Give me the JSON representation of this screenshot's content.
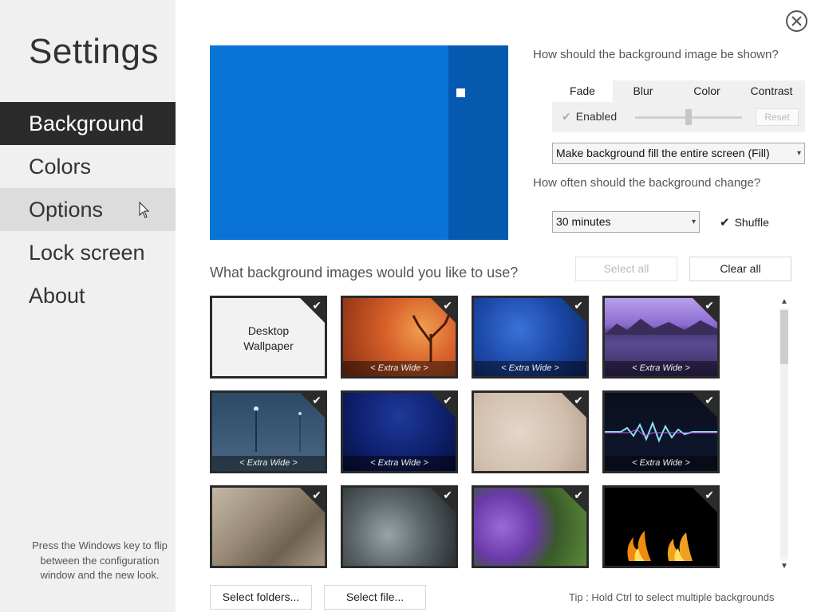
{
  "app": {
    "title": "Settings",
    "close_icon": "close-circle-icon"
  },
  "sidebar": {
    "items": [
      {
        "label": "Background",
        "state": "active"
      },
      {
        "label": "Colors",
        "state": "normal"
      },
      {
        "label": "Options",
        "state": "hover"
      },
      {
        "label": "Lock screen",
        "state": "normal"
      },
      {
        "label": "About",
        "state": "normal"
      }
    ],
    "tip": "Press the Windows key to flip between the configuration window and the new look."
  },
  "preview": {
    "main_color": "#0a74d6",
    "panel_color": "#055ab0"
  },
  "display": {
    "question": "How should the background image be shown?",
    "tabs": [
      "Fade",
      "Blur",
      "Color",
      "Contrast"
    ],
    "selected_tab": "Fade",
    "enabled_label": "Enabled",
    "slider_value": 0.5,
    "reset_label": "Reset",
    "fill_mode": "Make background fill the entire screen (Fill)"
  },
  "change": {
    "question": "How often should the background change?",
    "interval": "30 minutes",
    "shuffle_label": "Shuffle",
    "shuffle_checked": true
  },
  "images": {
    "question": "What background images would you like to use?",
    "select_all": "Select all",
    "clear_all": "Clear all",
    "desktop_line1": "Desktop",
    "desktop_line2": "Wallpaper",
    "extra_wide_label": "< Extra Wide >",
    "items": [
      {
        "type": "desktop",
        "checked": true
      },
      {
        "type": "autumn-tree",
        "extra_wide": true,
        "checked": true
      },
      {
        "type": "blue-bokeh",
        "extra_wide": true,
        "checked": true
      },
      {
        "type": "purple-mountain-lake",
        "extra_wide": true,
        "checked": true
      },
      {
        "type": "foggy-street-lamps",
        "extra_wide": false,
        "checked": true
      },
      {
        "type": "dark-blue-stars",
        "extra_wide": true,
        "checked": true
      },
      {
        "type": "beige-paper",
        "extra_wide": false,
        "checked": true
      },
      {
        "type": "sound-wave",
        "extra_wide": true,
        "checked": true
      },
      {
        "type": "stone-pavement",
        "extra_wide": false,
        "checked": true
      },
      {
        "type": "clay-pot",
        "extra_wide": false,
        "checked": true
      },
      {
        "type": "purple-vase",
        "extra_wide": false,
        "checked": true
      },
      {
        "type": "fire",
        "extra_wide": false,
        "checked": true
      }
    ]
  },
  "footer": {
    "select_folders": "Select folders...",
    "select_file": "Select file...",
    "tip": "Tip : Hold Ctrl to select multiple backgrounds"
  }
}
